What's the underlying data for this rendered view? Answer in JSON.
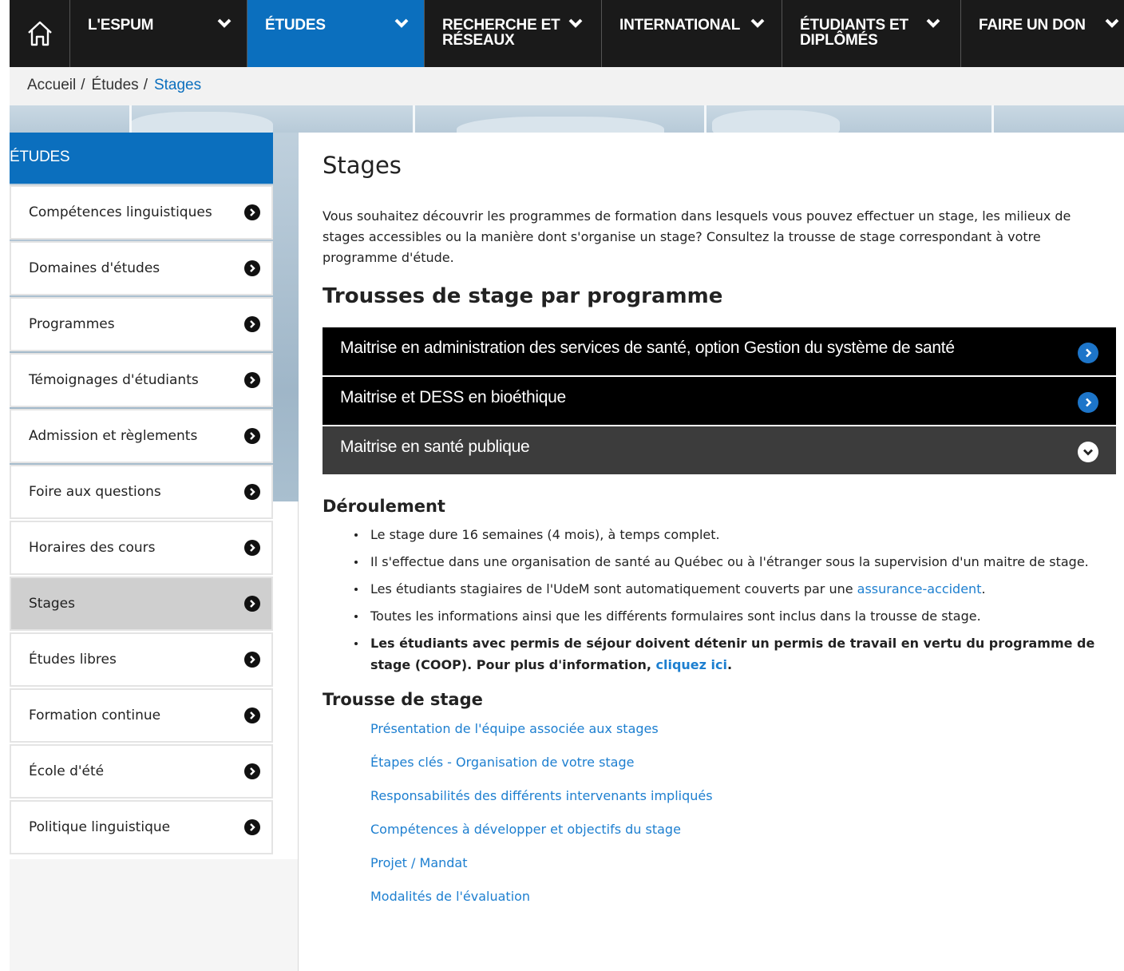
{
  "nav": {
    "home_icon": "home-icon",
    "items": [
      {
        "label": "L'ESPUM"
      },
      {
        "label": "ÉTUDES"
      },
      {
        "label": "RECHERCHE ET RÉSEAUX"
      },
      {
        "label": "INTERNATIONAL"
      },
      {
        "label": "ÉTUDIANTS ET DIPLÔMÉS"
      },
      {
        "label": "FAIRE UN DON"
      }
    ]
  },
  "breadcrumb": [
    "Accueil",
    "Études",
    "Stages"
  ],
  "sidebar": {
    "heading": "ÉTUDES",
    "items": [
      {
        "label": "Compétences linguistiques"
      },
      {
        "label": "Domaines d'études"
      },
      {
        "label": "Programmes"
      },
      {
        "label": "Témoignages d'étudiants"
      },
      {
        "label": "Admission et règlements"
      },
      {
        "label": "Foire aux questions"
      },
      {
        "label": "Horaires des cours"
      },
      {
        "label": "Stages"
      },
      {
        "label": "Études libres"
      },
      {
        "label": "Formation continue"
      },
      {
        "label": "École d'été"
      },
      {
        "label": "Politique linguistique"
      }
    ]
  },
  "main": {
    "title": "Stages",
    "intro": "Vous souhaitez découvrir les programmes de formation dans lesquels vous pouvez effectuer un stage, les milieux de stages accessibles ou la manière dont s'organise un stage? Consultez la trousse de stage correspondant à votre programme d'étude.",
    "subtitle": "Trousses de stage par programme",
    "accordion": [
      {
        "label": "Maitrise en administration des services de santé, option Gestion du système de santé",
        "state": "collapsed"
      },
      {
        "label": "Maitrise et DESS en bioéthique",
        "state": "collapsed"
      },
      {
        "label": "Maitrise en santé publique",
        "state": "expanded"
      }
    ],
    "deroulement": {
      "heading": "Déroulement",
      "b1": "Le stage dure 16 semaines (4 mois), à temps complet.",
      "b2": "Il s'effectue dans une organisation de santé au Québec ou à l'étranger sous la supervision d'un maitre de stage.",
      "b3_pre": "Les étudiants stagiaires de l'UdeM sont automatiquement couverts par une ",
      "b3_link": "assurance-accident",
      "b3_post": ".",
      "b4": "Toutes les informations ainsi que les différents formulaires sont inclus dans la trousse de stage.",
      "b5_pre": "Les étudiants avec permis de séjour doivent détenir un permis de travail en vertu du programme de stage (COOP). Pour plus d'information, ",
      "b5_link": "cliquez ici",
      "b5_post": "."
    },
    "trousse": {
      "heading": "Trousse de stage",
      "links": [
        "Présentation de l'équipe associée aux stages",
        "Étapes clés - Organisation de votre stage",
        "Responsabilités des différents intervenants impliqués",
        "Compétences à développer et objectifs du stage",
        "Projet / Mandat",
        "Modalités de l'évaluation"
      ]
    }
  },
  "colors": {
    "nav_bg": "#1a1a1a",
    "accent_blue": "#0b6fbe",
    "link_blue": "#1d7fd0",
    "accordion_bg": "#000000",
    "accordion_open_bg": "#3c3c3c"
  }
}
